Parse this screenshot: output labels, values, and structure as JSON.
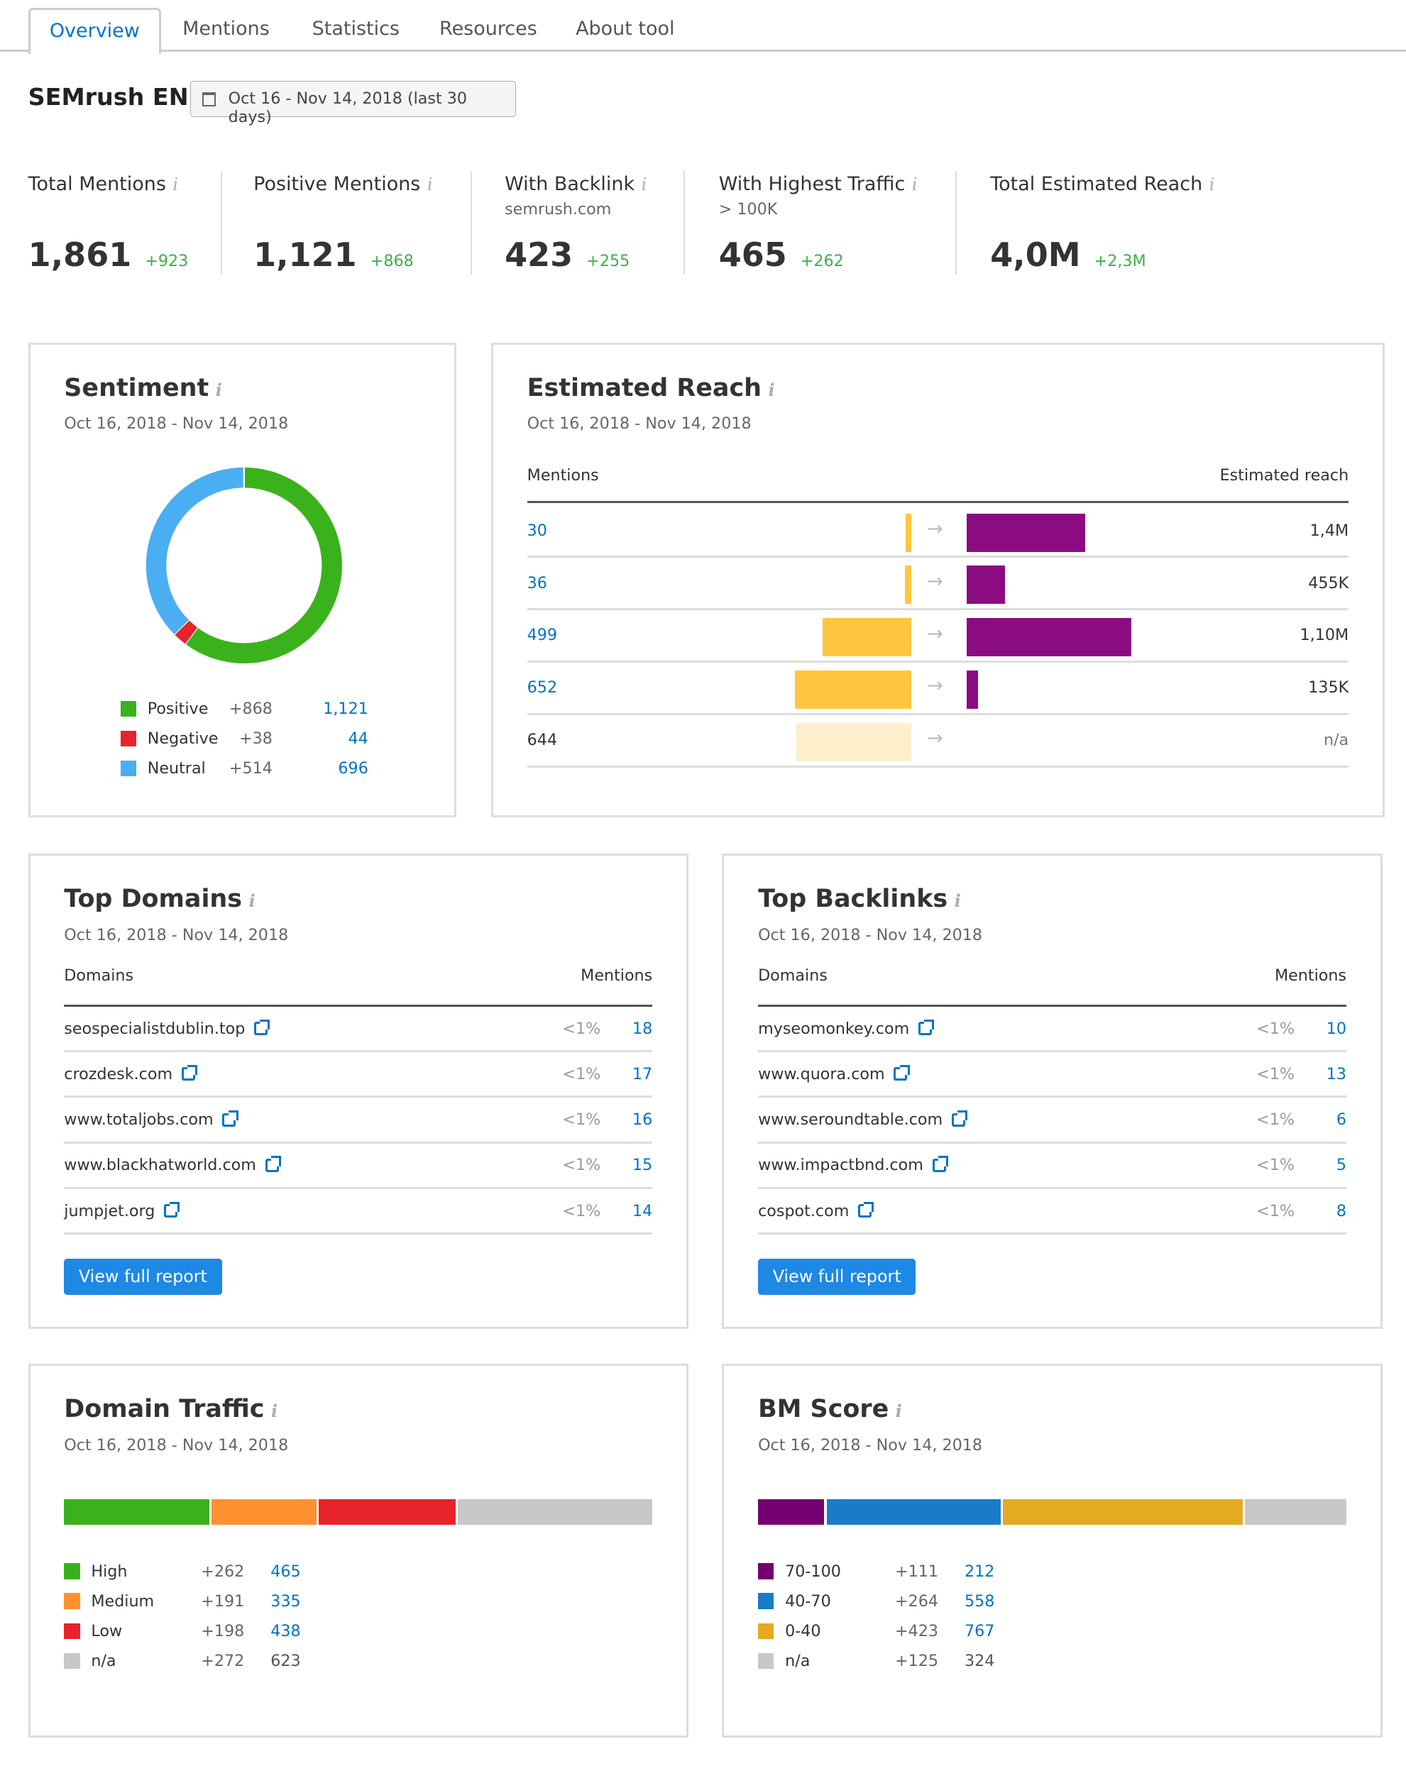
{
  "tabs": [
    "Overview",
    "Mentions",
    "Statistics",
    "Resources",
    "About tool"
  ],
  "header": {
    "title": "SEMrush EN",
    "date_range": "Oct 16 - Nov 14, 2018 (last 30 days)",
    "info": "i"
  },
  "metrics": [
    {
      "label": "Total Mentions",
      "sub": "",
      "value": "1,861",
      "delta": "+923"
    },
    {
      "label": "Positive Mentions",
      "sub": "",
      "value": "1,121",
      "delta": "+868"
    },
    {
      "label": "With Backlink",
      "sub": "semrush.com",
      "value": "423",
      "delta": "+255"
    },
    {
      "label": "With Highest Traffic",
      "sub": "> 100K",
      "value": "465",
      "delta": "+262"
    },
    {
      "label": "Total Estimated Reach",
      "sub": "",
      "value": "4,0M",
      "delta": "+2,3M"
    }
  ],
  "colors": {
    "positive": "#3ab21b",
    "negative": "#e8232a",
    "neutral": "#4aaef3",
    "mentions_bar": "#ffc73f",
    "mentions_na": "#fdefcb",
    "reach_bar": "#8b0c80",
    "link": "#0073c7",
    "delta": "#3cb043"
  },
  "sentiment": {
    "title": "Sentiment",
    "date": "Oct 16, 2018 - Nov 14, 2018",
    "items": [
      {
        "name": "Positive",
        "delta": "+868",
        "value": "1,121",
        "count": 1121,
        "color": "#3ab21b"
      },
      {
        "name": "Negative",
        "delta": "+38",
        "value": "44",
        "count": 44,
        "color": "#e8232a"
      },
      {
        "name": "Neutral",
        "delta": "+514",
        "value": "696",
        "count": 696,
        "color": "#4aaef3"
      }
    ]
  },
  "reach": {
    "title": "Estimated Reach",
    "date": "Oct 16, 2018 - Nov 14, 2018",
    "col_mentions": "Mentions",
    "col_reach": "Estimated reach",
    "rows": [
      {
        "mentions": "30",
        "count": 30,
        "reach": "1,4M",
        "reach_level": 0.31,
        "link": true
      },
      {
        "mentions": "36",
        "count": 36,
        "reach": "455K",
        "reach_level": 0.1,
        "link": true
      },
      {
        "mentions": "499",
        "count": 499,
        "reach": "1,10M",
        "reach_level": 0.43,
        "link": true
      },
      {
        "mentions": "652",
        "count": 652,
        "reach": "135K",
        "reach_level": 0.03,
        "link": true
      },
      {
        "mentions": "644",
        "count": 644,
        "reach": "n/a",
        "reach_level": 0,
        "link": false
      }
    ]
  },
  "top_domains": {
    "title": "Top Domains",
    "date": "Oct 16, 2018 - Nov 14, 2018",
    "col_domain": "Domains",
    "col_mentions": "Mentions",
    "button": "View full report",
    "rows": [
      {
        "domain": "seospecialistdublin.top",
        "pct": "<1%",
        "count": "18"
      },
      {
        "domain": "crozdesk.com",
        "pct": "<1%",
        "count": "17"
      },
      {
        "domain": "www.totaljobs.com",
        "pct": "<1%",
        "count": "16"
      },
      {
        "domain": "www.blackhatworld.com",
        "pct": "<1%",
        "count": "15"
      },
      {
        "domain": "jumpjet.org",
        "pct": "<1%",
        "count": "14"
      }
    ]
  },
  "top_backlinks": {
    "title": "Top Backlinks",
    "date": "Oct 16, 2018 - Nov 14, 2018",
    "col_domain": "Domains",
    "col_mentions": "Mentions",
    "button": "View full report",
    "rows": [
      {
        "domain": "myseomonkey.com",
        "pct": "<1%",
        "count": "10"
      },
      {
        "domain": "www.quora.com",
        "pct": "<1%",
        "count": "13"
      },
      {
        "domain": "www.seroundtable.com",
        "pct": "<1%",
        "count": "6"
      },
      {
        "domain": "www.impactbnd.com",
        "pct": "<1%",
        "count": "5"
      },
      {
        "domain": "cospot.com",
        "pct": "<1%",
        "count": "8"
      }
    ]
  },
  "domain_traffic": {
    "title": "Domain Traffic",
    "date": "Oct 16, 2018 - Nov 14, 2018",
    "items": [
      {
        "name": "High",
        "delta": "+262",
        "value": "465",
        "count": 465,
        "color": "#3ab21b",
        "link": true
      },
      {
        "name": "Medium",
        "delta": "+191",
        "value": "335",
        "count": 335,
        "color": "#ff9130",
        "link": true
      },
      {
        "name": "Low",
        "delta": "+198",
        "value": "438",
        "count": 438,
        "color": "#e8232a",
        "link": true
      },
      {
        "name": "n/a",
        "delta": "+272",
        "value": "623",
        "count": 623,
        "color": "#c8c8c8",
        "link": false
      }
    ]
  },
  "bm_score": {
    "title": "BM Score",
    "date": "Oct 16, 2018 - Nov 14, 2018",
    "items": [
      {
        "name": "70-100",
        "delta": "+111",
        "value": "212",
        "count": 212,
        "color": "#74006f",
        "link": true
      },
      {
        "name": "40-70",
        "delta": "+264",
        "value": "558",
        "count": 558,
        "color": "#1a7cc9",
        "link": true
      },
      {
        "name": "0-40",
        "delta": "+423",
        "value": "767",
        "count": 767,
        "color": "#e4aa21",
        "link": true
      },
      {
        "name": "n/a",
        "delta": "+125",
        "value": "324",
        "count": 324,
        "color": "#c8c8c8",
        "link": false
      }
    ]
  }
}
